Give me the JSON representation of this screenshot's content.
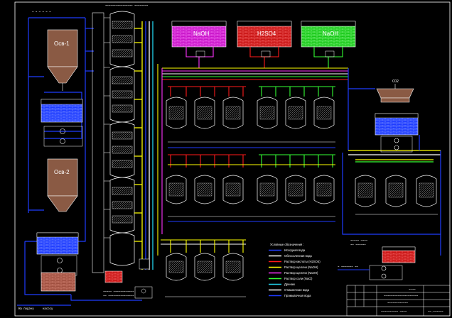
{
  "frame": {
    "border_color": "#ffffff",
    "background": "#000000"
  },
  "colors": {
    "blue": "#1f3cff",
    "white": "#ffffff",
    "yellow": "#ffff00",
    "red": "#ff1a1a",
    "magenta": "#ff33ff",
    "green": "#33ff33",
    "cyan": "#22d3ee",
    "tank_brown": "#8a5a44",
    "brick_magenta": "#c814c8",
    "brick_red": "#c81414",
    "brick_green": "#19c819",
    "brick_blue": "#1e3cff",
    "brick_brown": "#a05040"
  },
  "top_labels": {
    "top_left": "~ ~ ~ ~ ~ ~",
    "top_center": "~~~~~~~~~~~~~~~~ ~~~~~~~~"
  },
  "tanks": {
    "osb1": "Осв-1",
    "osb2": "Осв-2",
    "naoh": "NaOH",
    "h2so4": "H2SO4",
    "naoh2": "NaOH",
    "cyclone_top": "CO2",
    "reg_tank": "~~~~~~~~~~"
  },
  "side_labels": {
    "left_bottom": "На подачу",
    "left_bottom_2": "насосу",
    "center_bottom": "~~~~~ ~~~~~~~~~~~~",
    "center_bottom_2": "~~ ~~~~~~~~~~~~~~~",
    "right_mid": "~~~~~ ~~~~",
    "right_mid_2": "~~ ~~~~~~",
    "right_bottom": "~ ~~~~~~~ ~~"
  },
  "legend": {
    "title": "Условные обозначения :",
    "items": [
      {
        "label": "Исходная вода",
        "color": "#1f3cff"
      },
      {
        "label": "Обессоленная вода",
        "color": "#ffffff"
      },
      {
        "label": "Раствор кислоты (H2SO4)",
        "color": "#ff1a1a"
      },
      {
        "label": "Раствор щелочи (NaOH)",
        "color": "#ffff00"
      },
      {
        "label": "Раствор щелочи (NaOH)",
        "color": "#ff33ff"
      },
      {
        "label": "Раствор соли (NaCl)",
        "color": "#33ff33"
      },
      {
        "label": "Дренаж",
        "color": "#22d3ee"
      },
      {
        "label": "Отмывочная вода",
        "color": "#ffffff"
      },
      {
        "label": "Промывочная вода",
        "color": "#1f3cff"
      }
    ]
  },
  "title_block": {
    "line1": "~~~~",
    "line2": "~~~~~~~~~~~~~~~~~~~~",
    "line3": "~~~~~~~~~~~~",
    "left_code": "~~~~~~~~~~ ~~~~",
    "right_code": "~~.~~~~~~"
  }
}
